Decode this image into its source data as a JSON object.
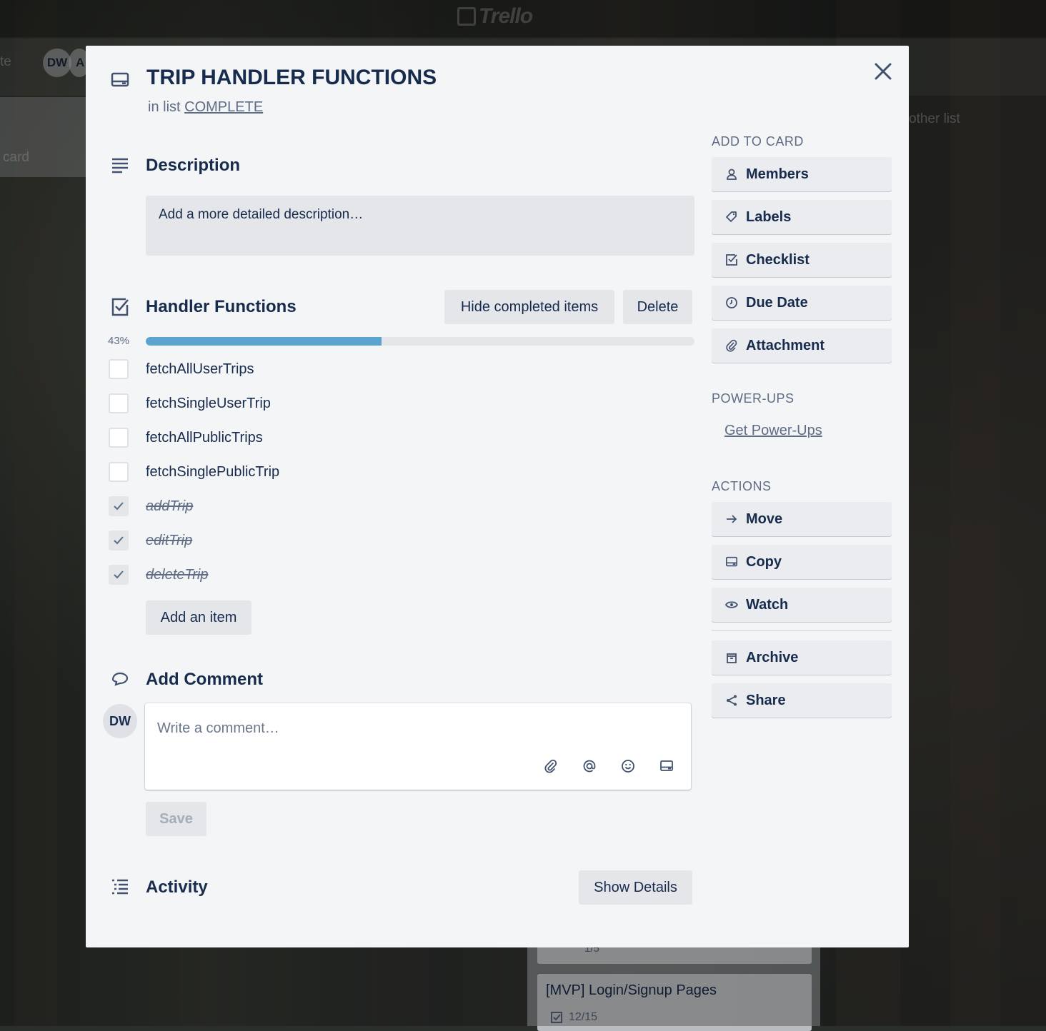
{
  "background": {
    "logo_text": "Trello",
    "header_text_left": "te",
    "member_avatar_1": "DW",
    "member_avatar_2": "A",
    "list_left_text": "card",
    "add_list_text": "other list",
    "card_mvp_title": "[MVP] Login/Signup Pages",
    "card_mvp_badge": "12/15",
    "card_above_badge": "1/5"
  },
  "card": {
    "title": "TRIP HANDLER FUNCTIONS",
    "in_list_prefix": "in list",
    "list_name": "COMPLETE",
    "close_icon": "close-icon"
  },
  "description": {
    "heading": "Description",
    "placeholder": "Add a more detailed description…"
  },
  "checklist": {
    "heading": "Handler Functions",
    "hide_button": "Hide completed items",
    "delete_button": "Delete",
    "progress_label": "43%",
    "progress_fraction": 0.43,
    "progress_color": "#5ba4cf",
    "items": [
      {
        "label": "fetchAllUserTrips",
        "checked": false
      },
      {
        "label": "fetchSingleUserTrip",
        "checked": false
      },
      {
        "label": "fetchAllPublicTrips",
        "checked": false
      },
      {
        "label": "fetchSinglePublicTrip",
        "checked": false
      },
      {
        "label": "addTrip",
        "checked": true
      },
      {
        "label": "editTrip",
        "checked": true
      },
      {
        "label": "deleteTrip",
        "checked": true
      }
    ],
    "add_item_button": "Add an item"
  },
  "comment": {
    "heading": "Add Comment",
    "avatar_initials": "DW",
    "placeholder": "Write a comment…",
    "save_button": "Save",
    "icons": [
      "attachment-icon",
      "mention-icon",
      "emoji-icon",
      "card-icon"
    ]
  },
  "activity": {
    "heading": "Activity",
    "show_details_button": "Show Details"
  },
  "sidebar": {
    "add_to_card_heading": "ADD TO CARD",
    "add_to_card": [
      {
        "label": "Members",
        "icon": "member-icon"
      },
      {
        "label": "Labels",
        "icon": "label-icon"
      },
      {
        "label": "Checklist",
        "icon": "checklist-icon"
      },
      {
        "label": "Due Date",
        "icon": "clock-icon"
      },
      {
        "label": "Attachment",
        "icon": "attachment-icon"
      }
    ],
    "powerups_heading": "POWER-UPS",
    "get_powerups_link": "Get Power-Ups",
    "actions_heading": "ACTIONS",
    "actions": [
      {
        "label": "Move",
        "icon": "arrow-right-icon"
      },
      {
        "label": "Copy",
        "icon": "card-icon"
      },
      {
        "label": "Watch",
        "icon": "eye-icon"
      },
      {
        "label": "Archive",
        "icon": "archive-icon"
      },
      {
        "label": "Share",
        "icon": "share-icon"
      }
    ]
  }
}
